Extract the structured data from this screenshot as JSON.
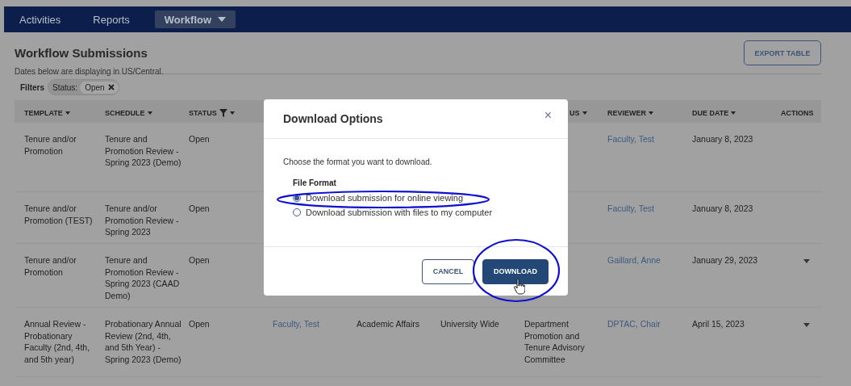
{
  "nav": {
    "items": [
      {
        "label": "Activities",
        "selected": false,
        "dropdown": false
      },
      {
        "label": "Reports",
        "selected": false,
        "dropdown": false
      },
      {
        "label": "Workflow",
        "selected": true,
        "dropdown": true
      }
    ]
  },
  "page": {
    "title": "Workflow Submissions",
    "subtitle": "Dates below are displaying in US/Central.",
    "export_button": "EXPORT TABLE"
  },
  "filters": {
    "label": "Filters",
    "chips": [
      {
        "name": "Status:",
        "value": "Open"
      }
    ]
  },
  "table": {
    "columns": [
      {
        "label": "TEMPLATE",
        "sortable": true,
        "filter": false
      },
      {
        "label": "SCHEDULE",
        "sortable": true,
        "filter": false
      },
      {
        "label": "STATUS",
        "sortable": true,
        "filter": true
      },
      null,
      null,
      null,
      {
        "label": "US",
        "sortable": true,
        "filter": false
      },
      {
        "label": "REVIEWER",
        "sortable": true,
        "filter": false
      },
      {
        "label": "DUE DATE",
        "sortable": true,
        "filter": false
      },
      {
        "label": "ACTIONS",
        "sortable": false,
        "filter": false
      }
    ],
    "rows": [
      {
        "cells": [
          "Tenure and/or Promotion",
          "Tenure and Promotion Review - Spring 2023 (Demo)",
          "Open",
          null,
          null,
          null,
          null,
          "Faculty, Test",
          "January 8, 2023"
        ],
        "actions_menu": false
      },
      {
        "cells": [
          "Tenure and/or Promotion (TEST)",
          "Tenure and/or Promotion Review - Spring 2023",
          "Open",
          null,
          null,
          null,
          null,
          "Faculty, Test",
          "January 8, 2023"
        ],
        "actions_menu": false
      },
      {
        "cells": [
          "Tenure and/or Promotion",
          "Tenure and Promotion Review - Spring 2023 (CAAD Demo)",
          "Open",
          null,
          null,
          null,
          null,
          "Gaillard, Anne",
          "January 29, 2023"
        ],
        "actions_menu": true
      },
      {
        "cells": [
          "Annual Review - Probationary Faculty (2nd, 4th, and 5th year)",
          "Probationary Annual Review (2nd, 4th, and 5th Year) - Spring 2023 (Demo)",
          "Open",
          "Faculty, Test",
          "Academic Affairs",
          "University Wide",
          "Department Promotion and Tenure Advisory Committee",
          "DPTAC, Chair",
          "April 15, 2023"
        ],
        "actions_menu": true
      }
    ]
  },
  "dialog": {
    "title": "Download Options",
    "close": "×",
    "prompt": "Choose the format you want to download.",
    "group_label": "File Format",
    "options": [
      {
        "label": "Download submission for online viewing",
        "selected": true
      },
      {
        "label": "Download submission with files to my computer",
        "selected": false
      }
    ],
    "buttons": [
      {
        "label": "CANCEL",
        "kind": "secondary"
      },
      {
        "label": "DOWNLOAD",
        "kind": "primary"
      }
    ]
  }
}
